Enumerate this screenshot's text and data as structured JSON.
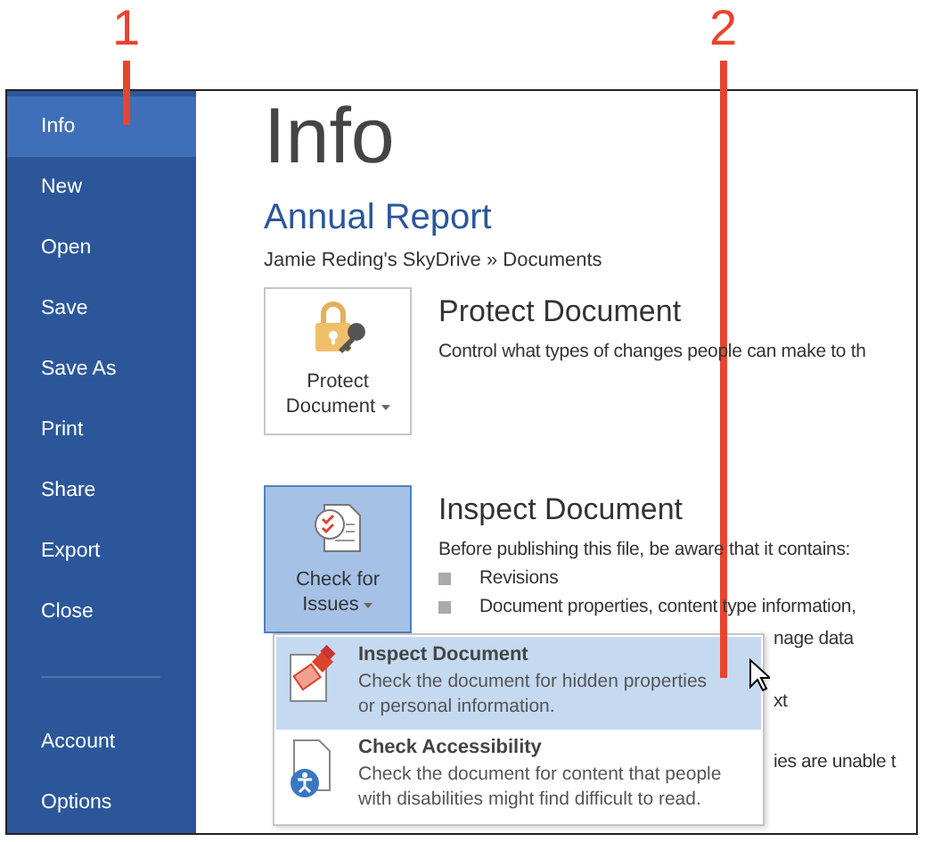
{
  "callouts": [
    {
      "label": "1"
    },
    {
      "label": "2"
    }
  ],
  "sidebar": {
    "items": [
      {
        "label": "Info",
        "selected": true
      },
      {
        "label": "New",
        "selected": false
      },
      {
        "label": "Open",
        "selected": false
      },
      {
        "label": "Save",
        "selected": false
      },
      {
        "label": "Save As",
        "selected": false
      },
      {
        "label": "Print",
        "selected": false
      },
      {
        "label": "Share",
        "selected": false
      },
      {
        "label": "Export",
        "selected": false
      },
      {
        "label": "Close",
        "selected": false
      }
    ],
    "footer_items": [
      {
        "label": "Account",
        "selected": false
      },
      {
        "label": "Options",
        "selected": false
      }
    ]
  },
  "header": {
    "title": "Info",
    "document_name": "Annual Report",
    "location": "Jamie Reding's SkyDrive » Documents"
  },
  "sections": [
    {
      "kind": "protect",
      "button": "Protect Document",
      "pressed": false,
      "title": "Protect Document",
      "description": "Control what types of changes people can make to th"
    },
    {
      "kind": "inspect",
      "button": "Check for Issues",
      "pressed": true,
      "title": "Inspect Document",
      "description": "Before publishing this file, be aware that it contains:",
      "bullets": [
        "Revisions",
        "Document properties, content type information,"
      ],
      "fragments": [
        "nage data",
        "xt",
        "ies are unable t"
      ]
    }
  ],
  "dropdown": {
    "items": [
      {
        "kind": "inspect",
        "title": "Inspect Document",
        "description": "Check the document for hidden properties or personal information.",
        "selected": true
      },
      {
        "kind": "accessibility",
        "title": "Check Accessibility",
        "description": "Check the document for content that people with disabilities might find difficult to read.",
        "selected": false
      }
    ]
  }
}
